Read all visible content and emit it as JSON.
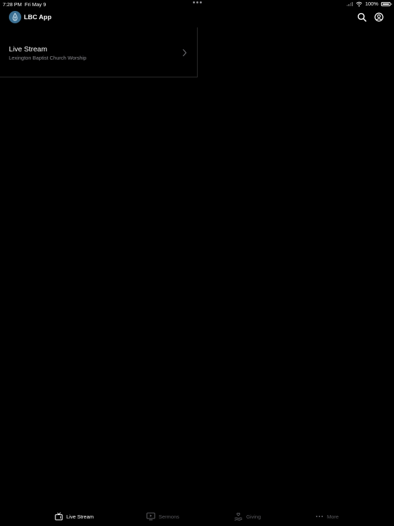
{
  "status_bar": {
    "time": "7:28 PM",
    "date": "Fri May 9",
    "battery": "100%"
  },
  "header": {
    "title": "LBC App",
    "logo_icon": "flame-drop-logo",
    "search_icon": "search-icon",
    "profile_icon": "profile-icon"
  },
  "list": {
    "items": [
      {
        "title": "Live Stream",
        "subtitle": "Lexington Baptist Church Worship"
      }
    ]
  },
  "tab_bar": {
    "tabs": [
      {
        "label": "Live Stream",
        "icon": "tv-icon",
        "active": true
      },
      {
        "label": "Sermons",
        "icon": "play-screen-icon",
        "active": false
      },
      {
        "label": "Giving",
        "icon": "giving-hand-icon",
        "active": false
      },
      {
        "label": "More",
        "icon": "ellipsis-icon",
        "active": false
      }
    ]
  },
  "colors": {
    "background": "#000000",
    "logo": "#3b6f92",
    "inactive_tab": "#5a5a5e",
    "subtitle": "#8e8e93"
  }
}
